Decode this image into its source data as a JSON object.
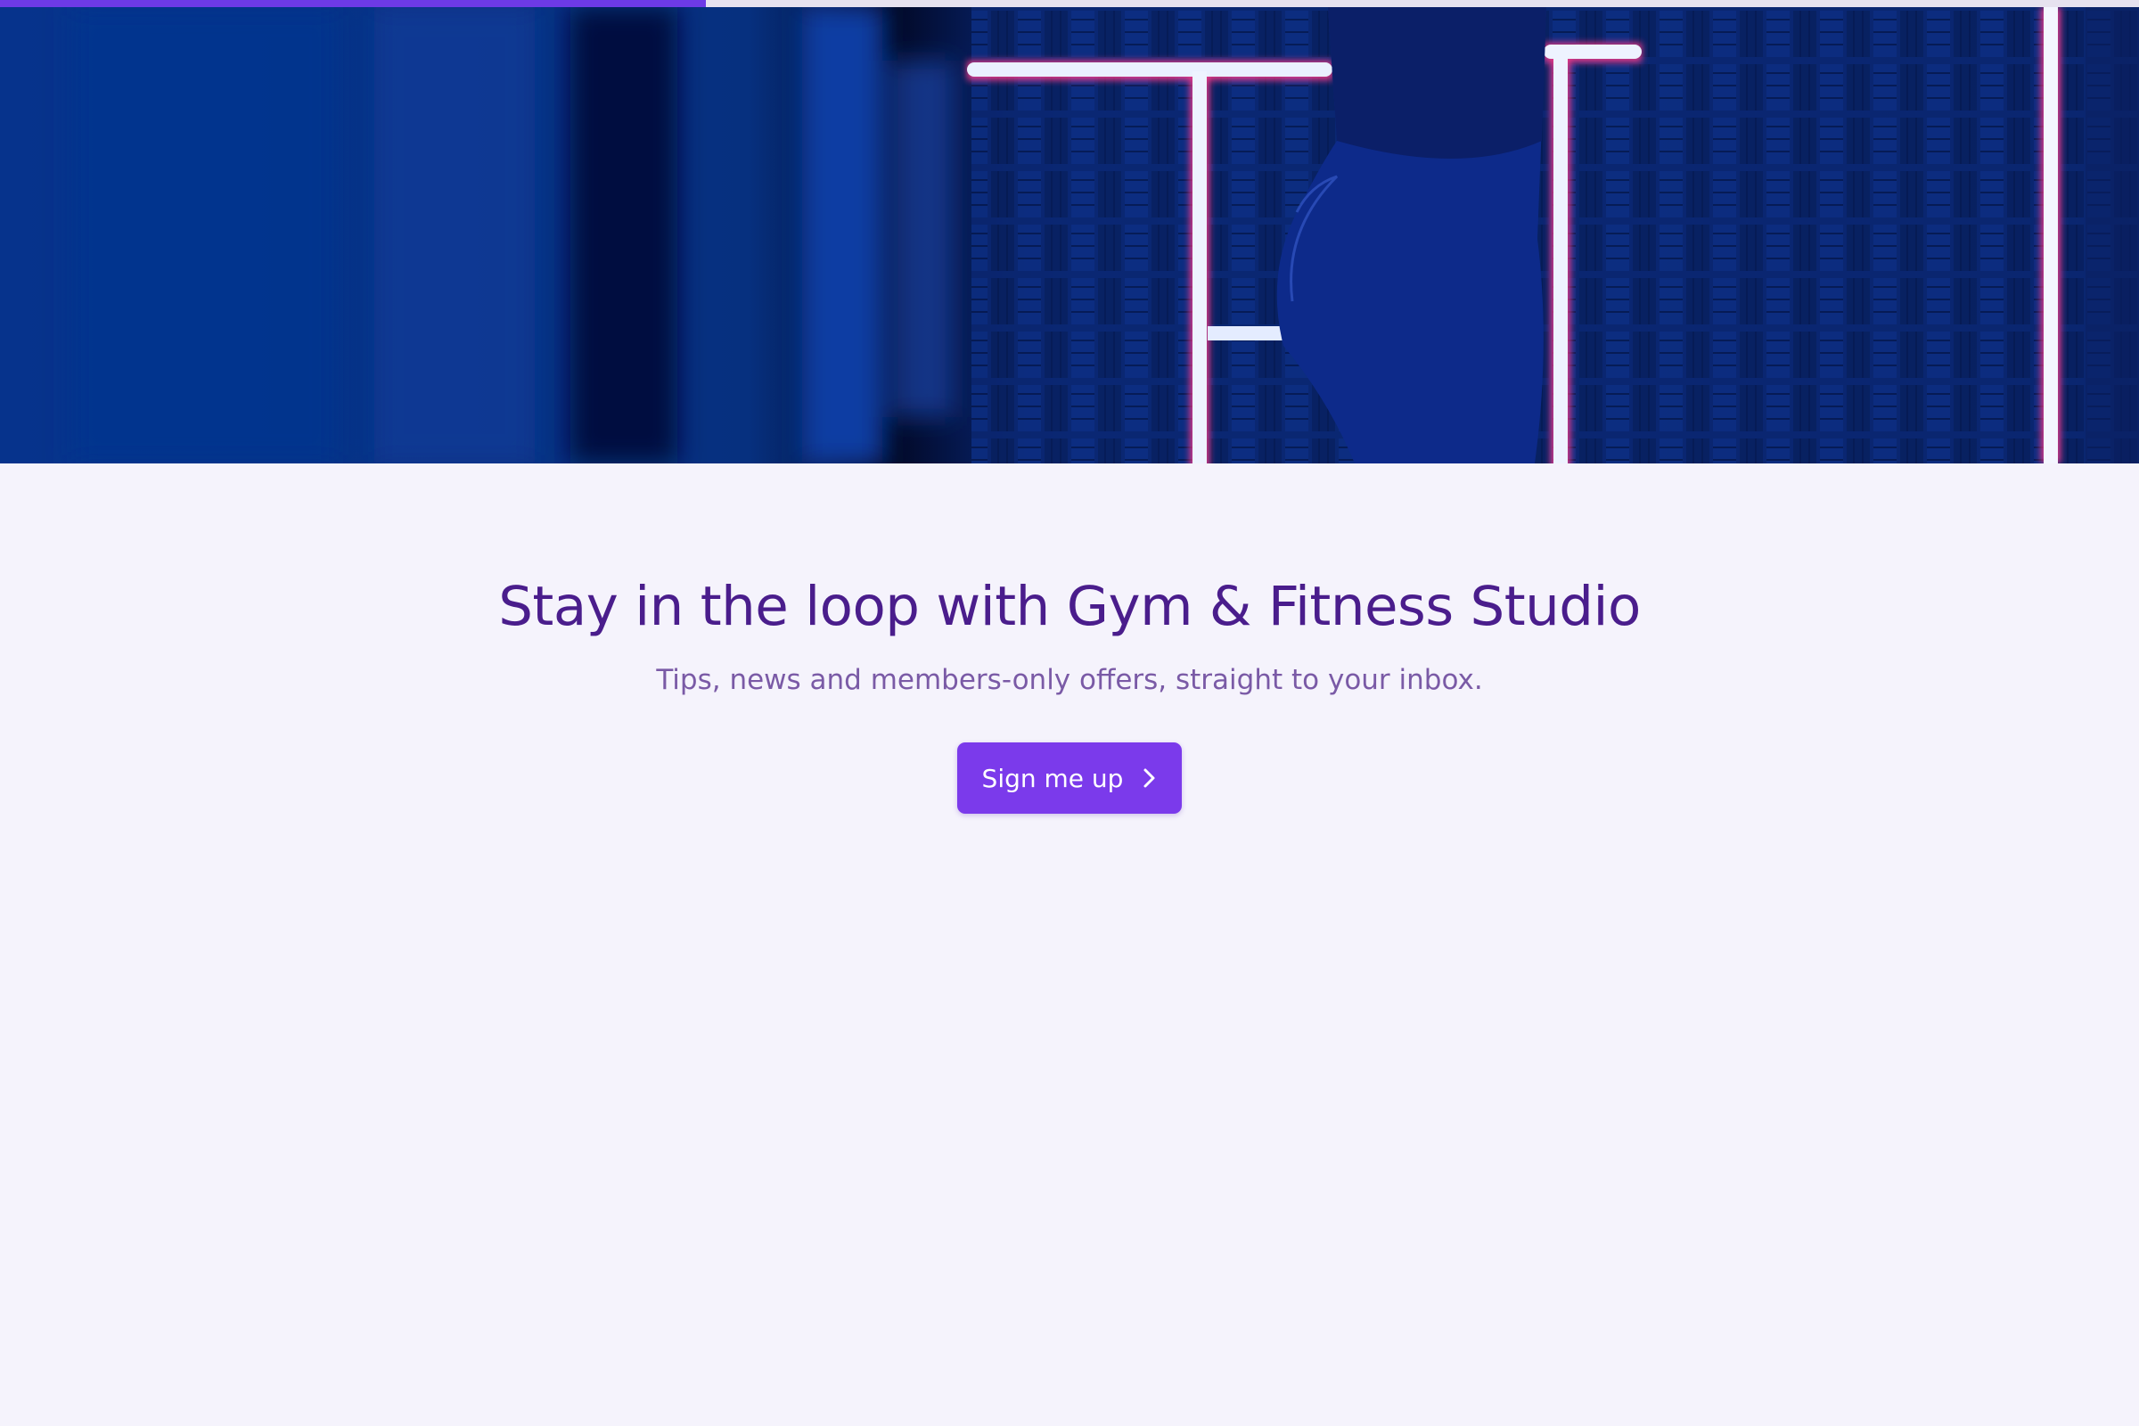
{
  "progress": {
    "fraction": 0.33
  },
  "hero": {
    "image_icon": "gym-neon-photo"
  },
  "newsletter": {
    "title": "Stay in the loop with Gym & Fitness Studio",
    "subtitle": "Tips, news and members-only offers, straight to your inbox.",
    "button_label": "Sign me up",
    "button_icon": "chevron-right-icon"
  },
  "colors": {
    "accent": "#7b3aeb",
    "title": "#4a1d8c",
    "subtitle": "#7a5aa6",
    "background": "#f5f3fc"
  }
}
